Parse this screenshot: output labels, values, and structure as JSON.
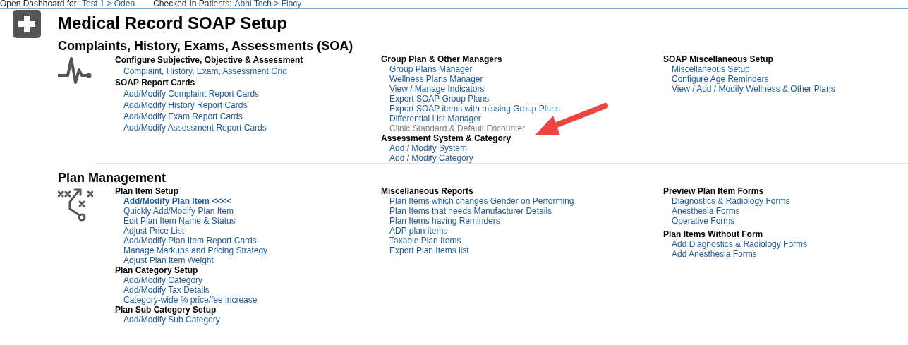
{
  "top_bar": {
    "dashboard_label": "Open Dashboard for:",
    "dashboard_link": "Test 1 > Oden",
    "patients_label": "Checked-In Patients:",
    "patients_link": "Abhi Tech > Flacy"
  },
  "page_title": "Medical Record SOAP Setup",
  "sections": [
    {
      "title": "Complaints, History, Exams, Assessments (SOA)",
      "columns": [
        [
          {
            "heading": "Configure Subjective, Objective & Assessment",
            "links": [
              {
                "text": "Complaint, History, Exam, Assessment Grid",
                "kind": "link"
              }
            ]
          },
          {
            "heading": "SOAP Report Cards",
            "links": [
              {
                "text": "Add/Modify Complaint Report Cards",
                "kind": "link"
              },
              {
                "text": "Add/Modify History Report Cards",
                "kind": "link"
              },
              {
                "text": "Add/Modify Exam Report Cards",
                "kind": "link"
              },
              {
                "text": "Add/Modify Assessment Report Cards",
                "kind": "link"
              }
            ]
          }
        ],
        [
          {
            "heading": "Group Plan & Other Managers",
            "links": [
              {
                "text": "Group Plans Manager",
                "kind": "link"
              },
              {
                "text": "Wellness Plans Manager",
                "kind": "link"
              },
              {
                "text": "View / Manage Indicators",
                "kind": "link"
              },
              {
                "text": "Export SOAP Group Plans",
                "kind": "link"
              },
              {
                "text": "Export SOAP items with missing Group Plans",
                "kind": "link"
              },
              {
                "text": "Differential List Manager",
                "kind": "link"
              },
              {
                "text": "Clinic Standard & Default Encounter",
                "kind": "dimmed"
              }
            ]
          },
          {
            "heading": "Assessment System & Category",
            "links": [
              {
                "text": "Add / Modify System",
                "kind": "link"
              },
              {
                "text": "Add / Modify Category",
                "kind": "link"
              }
            ]
          }
        ],
        [
          {
            "heading": "SOAP Miscellaneous Setup",
            "links": [
              {
                "text": "Miscellaneous Setup",
                "kind": "link"
              },
              {
                "text": "Configure Age Reminders",
                "kind": "link"
              },
              {
                "text": "View / Add / Modify Wellness & Other Plans",
                "kind": "link"
              }
            ]
          }
        ]
      ]
    },
    {
      "title": "Plan Management",
      "columns": [
        [
          {
            "heading": "Plan Item Setup",
            "links": [
              {
                "text": "Add/Modify Plan Item <<<<",
                "kind": "current"
              },
              {
                "text": "Quickly Add/Modify Plan Item",
                "kind": "link"
              },
              {
                "text": "Edit Plan Item Name & Status",
                "kind": "link"
              },
              {
                "text": "Adjust Price List",
                "kind": "link"
              },
              {
                "text": "Add/Modify Plan Item Report Cards",
                "kind": "link"
              },
              {
                "text": "Manage Markups and Pricing Strategy",
                "kind": "link"
              },
              {
                "text": "Adjust Plan Item Weight",
                "kind": "link"
              }
            ]
          },
          {
            "heading": "Plan Category Setup",
            "links": [
              {
                "text": "Add/Modify Category",
                "kind": "link"
              },
              {
                "text": "Add/Modify Tax Details",
                "kind": "link"
              },
              {
                "text": "Category-wide % price/fee increase",
                "kind": "link"
              }
            ]
          },
          {
            "heading": "Plan Sub Category Setup",
            "links": [
              {
                "text": "Add/Modify Sub Category",
                "kind": "link"
              }
            ]
          }
        ],
        [
          {
            "heading": "Miscellaneous Reports",
            "links": [
              {
                "text": "Plan Items which changes Gender on Performing",
                "kind": "link"
              },
              {
                "text": "Plan Items that needs Manufacturer Details",
                "kind": "link"
              },
              {
                "text": "Plan Items having Reminders",
                "kind": "link"
              },
              {
                "text": "ADP plan items",
                "kind": "link"
              },
              {
                "text": "Taxable Plan Items",
                "kind": "link"
              },
              {
                "text": "Export Plan Items list",
                "kind": "link"
              }
            ]
          }
        ],
        [
          {
            "heading": "Preview Plan Item Forms",
            "links": [
              {
                "text": "Diagnostics & Radiology Forms",
                "kind": "link"
              },
              {
                "text": "Anesthesia Forms",
                "kind": "link"
              },
              {
                "text": "Operative Forms",
                "kind": "link"
              }
            ]
          },
          {
            "heading": "Plan Items Without Form",
            "links": [
              {
                "text": "Add Diagnostics & Radiology Forms",
                "kind": "link"
              },
              {
                "text": "Add Anesthesia Forms",
                "kind": "link"
              }
            ]
          }
        ]
      ]
    }
  ]
}
